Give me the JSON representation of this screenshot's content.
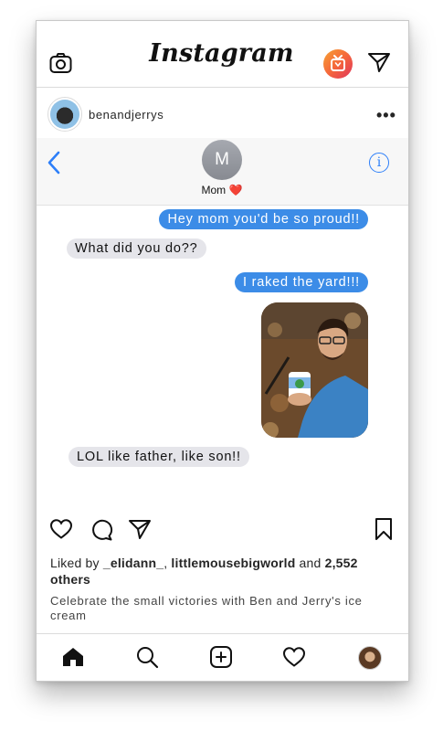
{
  "app": {
    "title": "Instagram"
  },
  "post": {
    "username": "benandjerrys",
    "more_label": "•••",
    "likes": {
      "prefix": "Liked by ",
      "user1": "_elidann_",
      "separator": ", ",
      "user2": "littlemousebigworld",
      "conjunction": " and ",
      "count": "2,552 others"
    },
    "caption": "Celebrate the small victories with Ben and Jerry's ice cream"
  },
  "imessage": {
    "contact_initial": "M",
    "contact_name": "Mom ❤️",
    "messages": [
      {
        "from": "me",
        "text": "Hey mom you'd be so proud!!"
      },
      {
        "from": "mom",
        "text": "What did you do??"
      },
      {
        "from": "me",
        "text": "I raked the yard!!!"
      },
      {
        "from": "me",
        "type": "photo"
      },
      {
        "from": "mom",
        "text": "LOL like father, like son!!"
      }
    ]
  },
  "icons": [
    "camera-icon",
    "igtv-icon",
    "direct-icon",
    "back-icon",
    "info-icon",
    "heart-icon",
    "comment-icon",
    "share-icon",
    "bookmark-icon",
    "home-icon",
    "search-icon",
    "add-icon",
    "activity-icon",
    "profile-icon"
  ],
  "colors": {
    "sent_bubble": "#3c8ce7",
    "received_bubble": "#e5e5ea",
    "ios_blue": "#2d7ff9",
    "igtv_gradient": [
      "#f7a233",
      "#e0345c"
    ]
  }
}
